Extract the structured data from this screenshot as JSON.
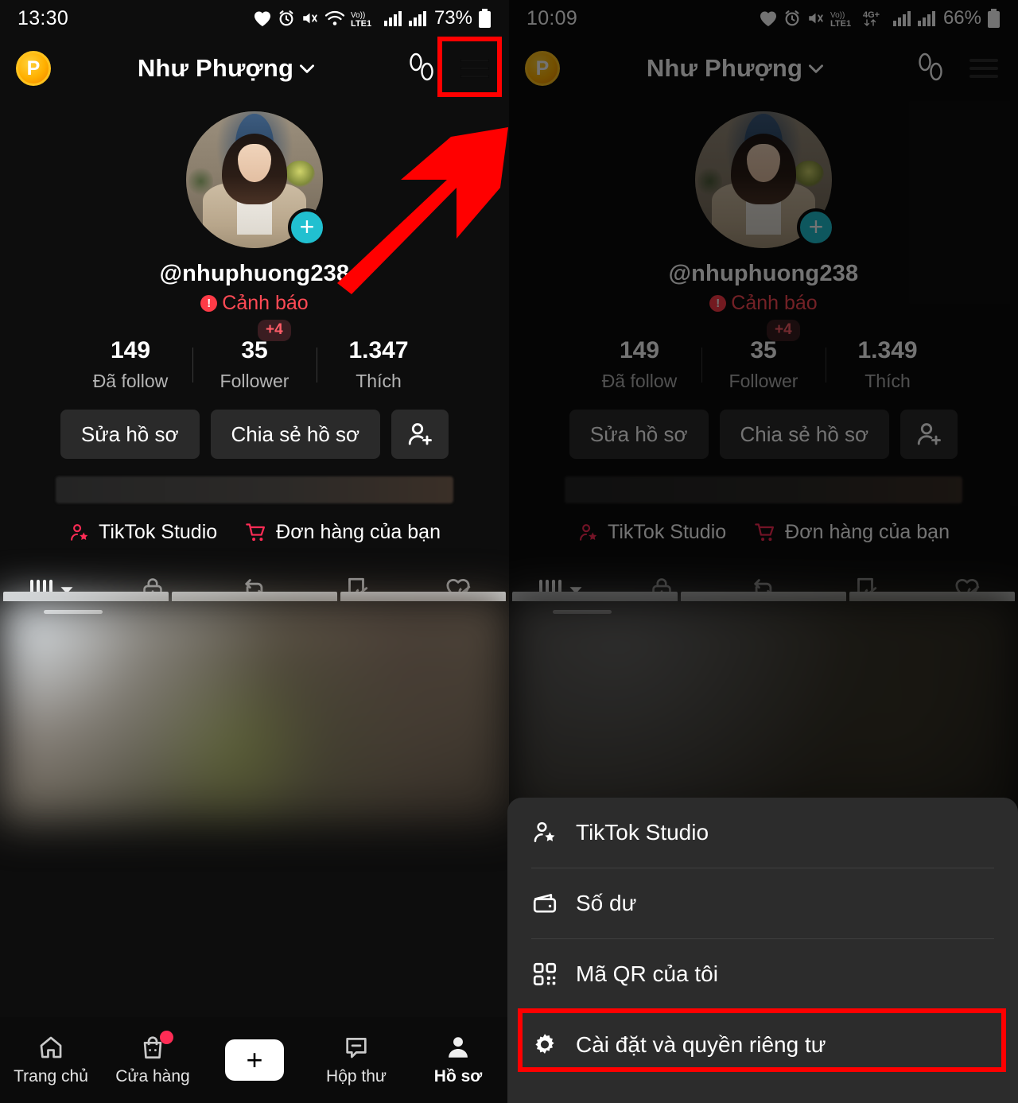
{
  "panels": {
    "left": {
      "status": {
        "time": "13:30",
        "battery": "73%",
        "icons": [
          "heart-icon",
          "alarm-icon",
          "mute-icon",
          "wifi-icon",
          "volte-lte1-icon",
          "signal-1-icon",
          "signal-2-icon",
          "battery-icon"
        ]
      },
      "header": {
        "coin_label": "P",
        "title": "Như Phượng",
        "chevron": "chevron-down-icon",
        "footprints": "footprints-icon",
        "menu": "hamburger-icon"
      },
      "profile": {
        "handle": "@nhuphuong238",
        "warning_label": "Cảnh báo",
        "warning_badge": "!",
        "plus_badge": "+",
        "stats": [
          {
            "num": "149",
            "label": "Đã follow",
            "delta": ""
          },
          {
            "num": "35",
            "label": "Follower",
            "delta": "+4"
          },
          {
            "num": "1.347",
            "label": "Thích",
            "delta": ""
          }
        ],
        "buttons": [
          {
            "label": "Sửa hồ sơ",
            "icon": ""
          },
          {
            "label": "Chia sẻ hồ sơ",
            "icon": ""
          },
          {
            "label": "",
            "icon": "add-person-icon"
          }
        ],
        "quick_links": [
          {
            "label": "TikTok Studio",
            "icon": "person-star-icon"
          },
          {
            "label": "Đơn hàng của bạn",
            "icon": "cart-icon"
          }
        ],
        "tabs": [
          {
            "icon": "grid-posts-icon",
            "active": true
          },
          {
            "icon": "lock-icon",
            "active": false
          },
          {
            "icon": "repost-icon",
            "active": false
          },
          {
            "icon": "saved-hidden-icon",
            "active": false
          },
          {
            "icon": "liked-hidden-icon",
            "active": false
          }
        ]
      },
      "bottom_nav": [
        {
          "label": "Trang chủ",
          "icon": "home-icon",
          "active": false,
          "dot": false
        },
        {
          "label": "Cửa hàng",
          "icon": "shop-bag-icon",
          "active": false,
          "dot": true
        },
        {
          "label": "",
          "icon": "create-plus-icon",
          "active": false,
          "dot": false
        },
        {
          "label": "Hộp thư",
          "icon": "inbox-icon",
          "active": false,
          "dot": false
        },
        {
          "label": "Hồ sơ",
          "icon": "profile-person-icon",
          "active": true,
          "dot": false
        }
      ]
    },
    "right": {
      "status": {
        "time": "10:09",
        "battery": "66%",
        "icons": [
          "heart-icon",
          "alarm-icon",
          "mute-icon",
          "volte-lte1-icon",
          "4g-plus-icon",
          "signal-1-icon",
          "signal-2-icon",
          "battery-icon"
        ],
        "network": "4G+"
      },
      "header": {
        "coin_label": "P",
        "title": "Như Phượng"
      },
      "profile": {
        "handle": "@nhuphuong238",
        "warning_label": "Cảnh báo",
        "stats": [
          {
            "num": "149",
            "label": "Đã follow",
            "delta": ""
          },
          {
            "num": "35",
            "label": "Follower",
            "delta": "+4"
          },
          {
            "num": "1.349",
            "label": "Thích",
            "delta": ""
          }
        ],
        "buttons": [
          {
            "label": "Sửa hồ sơ"
          },
          {
            "label": "Chia sẻ hồ sơ"
          },
          {
            "label": ""
          }
        ],
        "quick_links": [
          {
            "label": "TikTok Studio"
          },
          {
            "label": "Đơn hàng của bạn"
          }
        ]
      },
      "menu": {
        "items": [
          {
            "label": "TikTok Studio",
            "icon": "person-star-icon",
            "highlighted": false
          },
          {
            "label": "Số dư",
            "icon": "wallet-icon",
            "highlighted": false
          },
          {
            "label": "Mã QR của tôi",
            "icon": "qr-code-icon",
            "highlighted": false
          },
          {
            "label": "Cài đặt và quyền riêng tư",
            "icon": "gear-icon",
            "highlighted": true
          }
        ]
      }
    }
  },
  "annotations": {
    "highlight_color": "#ff0000",
    "arrow": "red-arrow-up-right",
    "targets": [
      "hamburger-icon",
      "Cài đặt và quyền riêng tư"
    ]
  },
  "colors": {
    "accent_pink": "#fe2c55",
    "accent_cyan": "#29e4f0",
    "warning_red": "#ff4a55",
    "badge_teal": "#21c0d0",
    "coin_gold": "#ffb000",
    "menu_bg": "#2c2c2c",
    "page_bg": "#0d0d0d"
  }
}
